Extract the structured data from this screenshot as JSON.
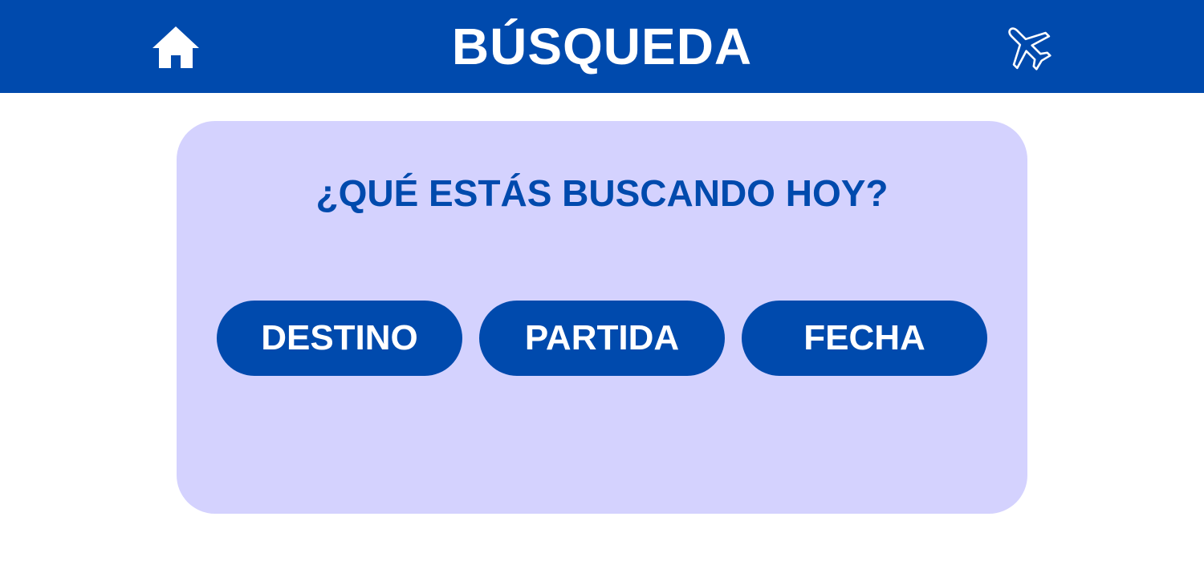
{
  "header": {
    "title": "BÚSQUEDA",
    "home_icon": "home-icon",
    "plane_icon": "airplane-icon",
    "background_color": "#004aad",
    "text_color": "#ffffff"
  },
  "search_card": {
    "question": "¿QUÉ ESTÁS BUSCANDO HOY?",
    "background_color": "#d4d2fe",
    "accent_color": "#004aad",
    "options": [
      {
        "label": "DESTINO"
      },
      {
        "label": "PARTIDA"
      },
      {
        "label": "FECHA"
      }
    ]
  }
}
